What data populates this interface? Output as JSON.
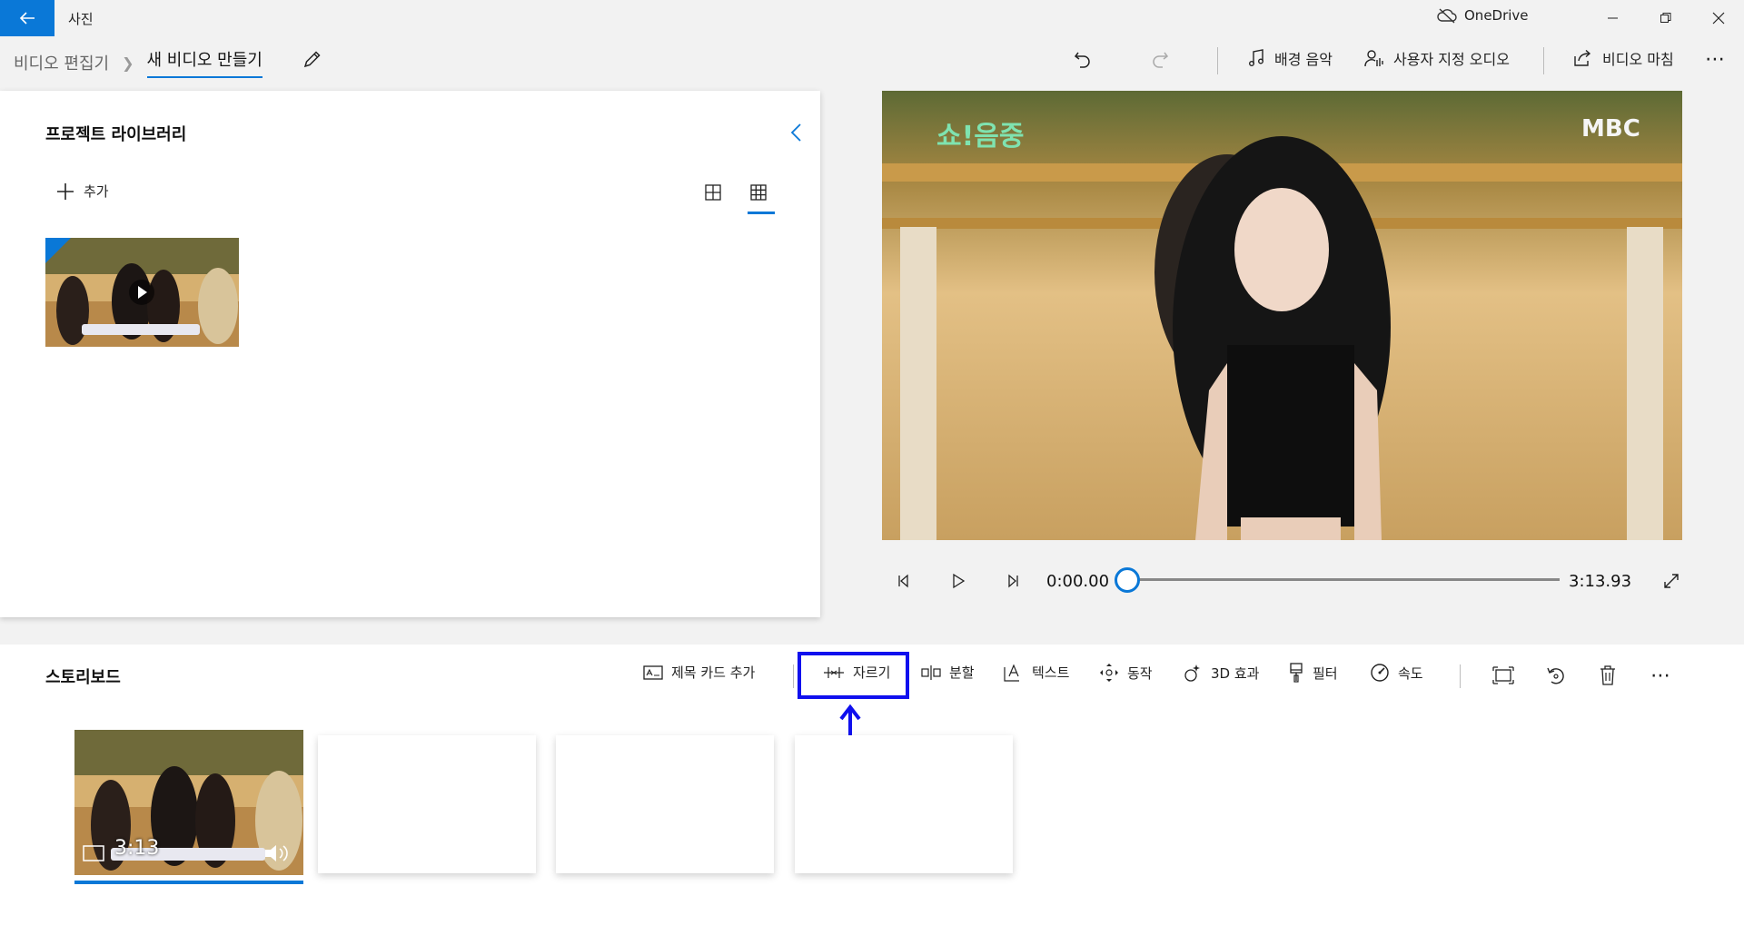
{
  "window": {
    "app_title": "사진",
    "onedrive_label": "OneDrive"
  },
  "breadcrumb": {
    "parent": "비디오 편집기",
    "current": "새 비디오 만들기"
  },
  "commands": {
    "background_music": "배경 음악",
    "custom_audio": "사용자 지정 오디오",
    "finish_video": "비디오 마침"
  },
  "library": {
    "title": "프로젝트 라이브러리",
    "add_label": "추가"
  },
  "player": {
    "current_time": "0:00.00",
    "total_time": "3:13.93",
    "progress": 0
  },
  "storyboard": {
    "title": "스토리보드",
    "tools": {
      "title_card": "제목 카드 추가",
      "trim": "자르기",
      "split": "분할",
      "text": "텍스트",
      "motion": "동작",
      "effects_3d": "3D 효과",
      "filters": "필터",
      "speed": "속도"
    },
    "clip": {
      "duration": "3:13"
    }
  },
  "preview": {
    "watermark_left": "쇼!음중",
    "watermark_right": "MBC"
  },
  "colors": {
    "accent": "#0a78d7",
    "annotation": "#1010ee"
  }
}
